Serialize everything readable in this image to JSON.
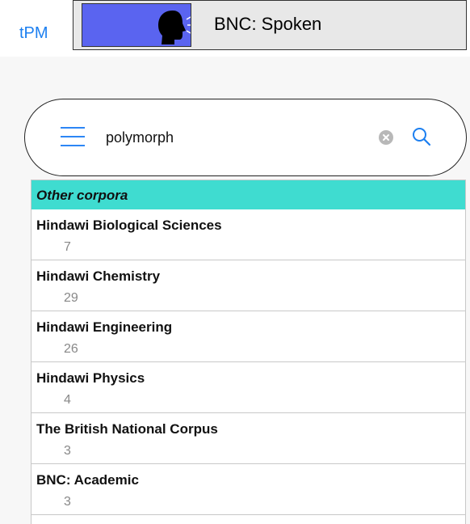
{
  "header": {
    "link_label": "tPM",
    "corpus_title": "BNC: Spoken",
    "corpus_thumbnail_icon": "speaking-head-icon"
  },
  "search": {
    "menu_icon": "hamburger-menu-icon",
    "query": "polymorph",
    "clear_icon": "clear-icon",
    "search_icon": "search-icon"
  },
  "results": {
    "section_title": "Other corpora",
    "section_color": "#3fdcd0",
    "items": [
      {
        "name": "Hindawi Biological Sciences",
        "count": "7"
      },
      {
        "name": "Hindawi Chemistry",
        "count": "29"
      },
      {
        "name": "Hindawi Engineering",
        "count": "26"
      },
      {
        "name": "Hindawi Physics",
        "count": "4"
      },
      {
        "name": "The British National Corpus",
        "count": "3"
      },
      {
        "name": "BNC: Academic",
        "count": "3"
      }
    ]
  },
  "colors": {
    "accent": "#1c7ff0",
    "thumbnail_bg": "#5a64f0",
    "count_text": "#888888"
  }
}
